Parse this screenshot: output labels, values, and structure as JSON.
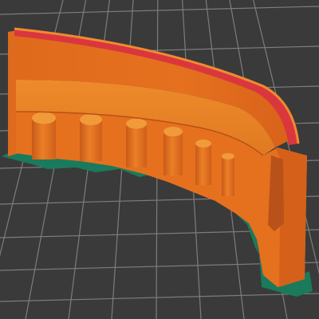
{
  "viewport": {
    "view": "3d-preview",
    "bed": {
      "background_color": "#3a3a3a",
      "grid_color": "#7d7d7d"
    },
    "model": {
      "name": "curved-wall-slice-preview",
      "colors": {
        "perimeter": "#e5711f",
        "perimeter_shadow": "#c4561a",
        "infill": "#e8962f",
        "top_solid": "#d9373d",
        "brim": "#1a7a5c"
      }
    }
  }
}
